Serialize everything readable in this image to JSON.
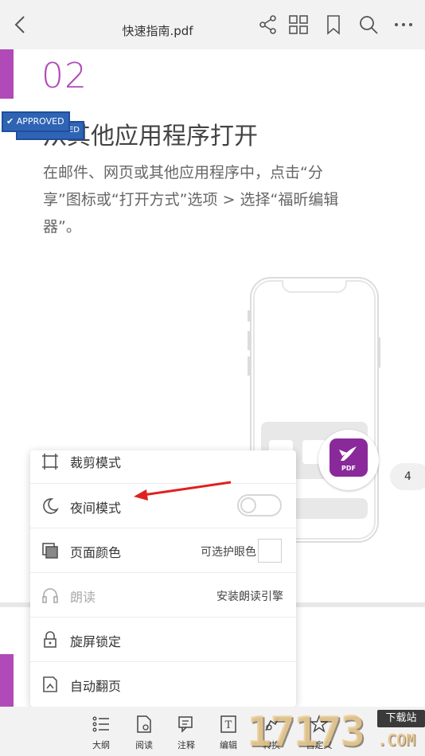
{
  "header": {
    "title": "快速指南.pdf",
    "icons": [
      "back-icon",
      "share-icon",
      "grid-icon",
      "bookmark-icon",
      "search-icon",
      "more-icon"
    ]
  },
  "document": {
    "section_number": "02",
    "heading": "从其他应用程序打开",
    "paragraph": "在邮件、网页或其他应用程序中，点击“分享”图标或“打开方式”选项 > 选择“福昕编辑器”。",
    "stamp_text": "APPROVED",
    "stamp_text_back": "ED",
    "app_icon_label": "PDF",
    "page_badge": "4",
    "accent_color": "#b04ab8"
  },
  "menu": {
    "items": [
      {
        "label": "裁剪模式",
        "icon": "crop-icon",
        "right": ""
      },
      {
        "label": "夜间模式",
        "icon": "moon-icon",
        "right": "",
        "toggle": false
      },
      {
        "label": "页面颜色",
        "icon": "page-color-icon",
        "right": "可选护眼色"
      },
      {
        "label": "朗读",
        "icon": "headphones-icon",
        "right": "安装朗读引擎",
        "disabled": true
      },
      {
        "label": "旋屏锁定",
        "icon": "lock-icon",
        "right": ""
      },
      {
        "label": "自动翻页",
        "icon": "auto-page-icon",
        "right": ""
      }
    ]
  },
  "toolbar": {
    "items": [
      {
        "label": "大纲",
        "icon": "outline-icon"
      },
      {
        "label": "阅读",
        "icon": "read-icon"
      },
      {
        "label": "注释",
        "icon": "comment-icon"
      },
      {
        "label": "编辑",
        "icon": "edit-icon"
      },
      {
        "label": "转换",
        "icon": "convert-icon"
      },
      {
        "label": "自定义",
        "icon": "custom-icon"
      }
    ]
  },
  "watermark": {
    "digits": "17173",
    "tag": "下载站",
    "com": ".COM"
  },
  "annotation": {
    "arrow_color": "#e02020"
  }
}
